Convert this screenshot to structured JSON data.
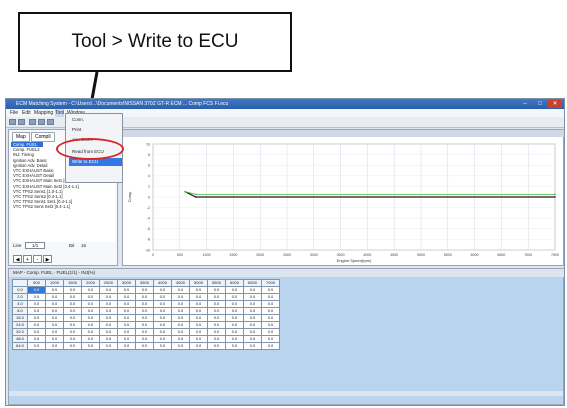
{
  "callout": {
    "text": "Tool > Write to ECU"
  },
  "window": {
    "title": "ECM Matching System - C:\\Users\\...\\Documents\\NISSAN 370Z GT-R ECM ... Comp FCS Fi.ecu",
    "controls": [
      "–",
      "□",
      "✕"
    ]
  },
  "menubar": {
    "items": [
      "File",
      "Edit",
      "Mapping",
      "Tool",
      "Window"
    ]
  },
  "toolbar": {
    "icons": [
      "open-icon",
      "save-icon",
      "copy-icon",
      "paste-icon",
      "undo-icon"
    ]
  },
  "left_panel": {
    "tabs": [
      "Map",
      "Compil"
    ],
    "maps": [
      "Comp. FUEL",
      "Comp. FUEL2",
      "INJ. Timing",
      "Ignition Adv. Basic",
      "Ignition Adv. Detail",
      "VTC EXHAUST Basic",
      "VTC EXHAUST Detail",
      "VTC EXHAUST Main Set1  [0.4-1.1]",
      "VTC EXHAUST Main Set2  [0.4-1.1]",
      "VTC TPS2 Sens1  [1.0-1.1]",
      "VTC TPS2 Sens2  [0.4-1.1]",
      "VTC TPS2 Sens1 Set1  [0.4-1.1]",
      "VTC TPS2 Sens Set2  [0.4-1.1]"
    ],
    "line_label": "Line",
    "line_value": "1/1",
    "bit_label": "Bit",
    "bit_value": "16",
    "step_buttons": [
      "◀",
      "+",
      "-",
      "▶"
    ]
  },
  "dropdown": {
    "items": [
      "Conn.",
      "Print",
      "Aux Conn.",
      "Read from ECU",
      "Write to ECU"
    ],
    "selected": "Write to ECU"
  },
  "chart_data": {
    "type": "line",
    "title": "",
    "xlabel": "Engine Speed(rpm)",
    "ylabel": "Comp",
    "xlim": [
      0,
      7500
    ],
    "ylim": [
      -10,
      10
    ],
    "x_ticks": [
      0,
      500,
      1000,
      1500,
      2000,
      2500,
      3000,
      3500,
      4000,
      4500,
      5000,
      5500,
      6000,
      6500,
      7000,
      7500
    ],
    "y_ticks": [
      10,
      8,
      6,
      4,
      2,
      0,
      -2,
      -4,
      -6,
      -8,
      -10
    ],
    "series": [
      {
        "x": [
          600,
          800,
          7500
        ],
        "y": [
          1.0,
          0.0,
          0.0
        ],
        "color": "#3a0d0d"
      },
      {
        "x": [
          600,
          800,
          7500
        ],
        "y": [
          1.0,
          0.5,
          0.5
        ],
        "color": "#33bb44"
      }
    ],
    "grid": true
  },
  "table": {
    "title": "MAP - Comp. FUEL  ·  FUEL(1/1) - INJ(%)",
    "columns": [
      "",
      "500",
      "1000",
      "1500",
      "2000",
      "2500",
      "3000",
      "3500",
      "4000",
      "4500",
      "5000",
      "5500",
      "6000",
      "6500",
      "7000"
    ],
    "rows": [
      {
        "label": "0.0",
        "cells": [
          "0.0",
          "0.0",
          "0.0",
          "0.0",
          "0.0",
          "0.0",
          "0.0",
          "0.0",
          "0.0",
          "0.0",
          "0.0",
          "0.0",
          "0.0",
          "0.0"
        ]
      },
      {
        "label": "2.0",
        "cells": [
          "0.0",
          "0.0",
          "0.0",
          "0.0",
          "0.0",
          "0.0",
          "0.0",
          "0.0",
          "0.0",
          "0.0",
          "0.0",
          "0.0",
          "0.0",
          "0.0"
        ]
      },
      {
        "label": "4.0",
        "cells": [
          "0.0",
          "0.0",
          "0.0",
          "0.0",
          "0.0",
          "0.0",
          "0.0",
          "0.0",
          "0.0",
          "0.0",
          "0.0",
          "0.0",
          "0.0",
          "0.0"
        ]
      },
      {
        "label": "8.0",
        "cells": [
          "0.0",
          "0.0",
          "0.0",
          "0.0",
          "0.0",
          "0.0",
          "0.0",
          "0.0",
          "0.0",
          "0.0",
          "0.0",
          "0.0",
          "0.0",
          "0.0"
        ]
      },
      {
        "label": "16.0",
        "cells": [
          "0.0",
          "0.0",
          "0.0",
          "0.0",
          "0.0",
          "0.0",
          "0.0",
          "0.0",
          "0.0",
          "0.0",
          "0.0",
          "0.0",
          "0.0",
          "0.0"
        ]
      },
      {
        "label": "24.0",
        "cells": [
          "0.0",
          "0.0",
          "0.0",
          "0.0",
          "0.0",
          "0.0",
          "0.0",
          "0.0",
          "0.0",
          "0.0",
          "0.0",
          "0.0",
          "0.0",
          "0.0"
        ]
      },
      {
        "label": "32.0",
        "cells": [
          "0.0",
          "0.0",
          "0.0",
          "0.0",
          "0.0",
          "0.0",
          "0.0",
          "0.0",
          "0.0",
          "0.0",
          "0.0",
          "0.0",
          "0.0",
          "0.0"
        ]
      },
      {
        "label": "48.0",
        "cells": [
          "0.0",
          "0.0",
          "0.0",
          "0.0",
          "0.0",
          "0.0",
          "0.0",
          "0.0",
          "0.0",
          "0.0",
          "0.0",
          "0.0",
          "0.0",
          "0.0"
        ]
      },
      {
        "label": "64.0",
        "cells": [
          "0.0",
          "0.0",
          "0.0",
          "0.0",
          "0.0",
          "0.0",
          "0.0",
          "0.0",
          "0.0",
          "0.0",
          "0.0",
          "0.0",
          "0.0",
          "0.0"
        ]
      }
    ]
  },
  "colors": {
    "highlight": "#d82626",
    "selection": "#3578e5",
    "table_bg": "#b9d4ee"
  }
}
